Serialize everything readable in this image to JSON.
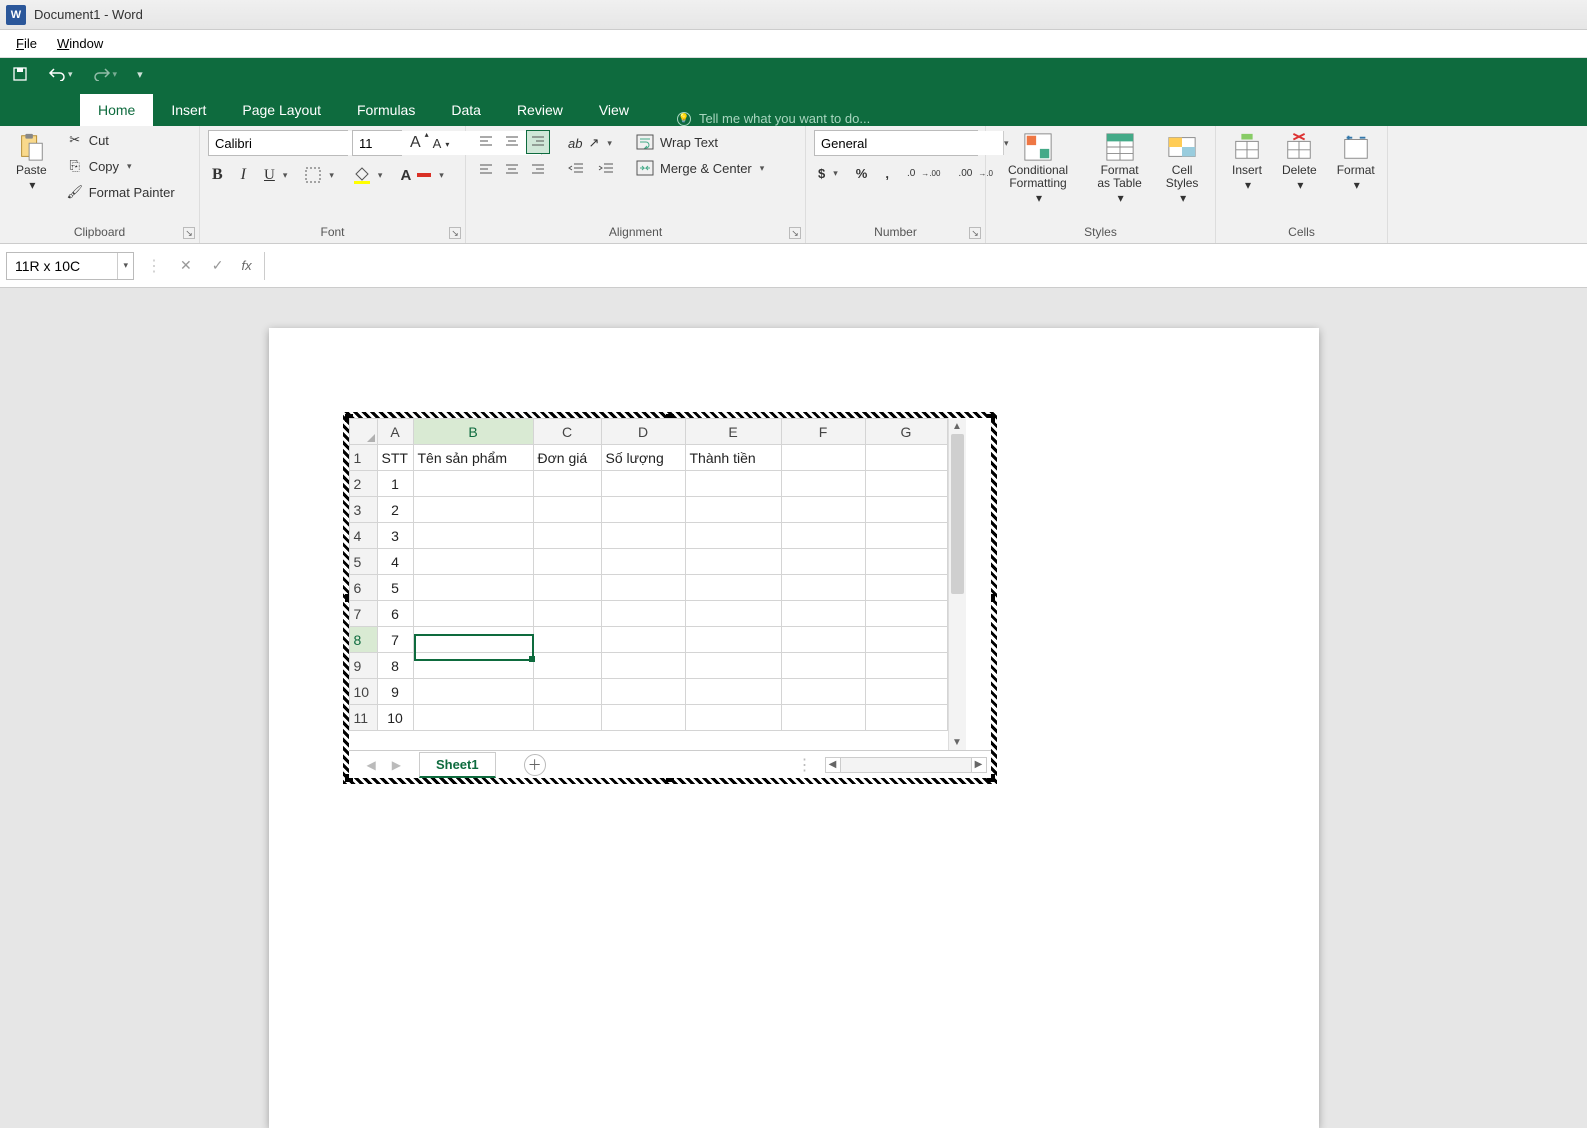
{
  "title": "Document1 - Word",
  "menu": {
    "file": "File",
    "window": "Window"
  },
  "qat": {
    "save": "save",
    "undo": "undo",
    "redo": "redo",
    "customize": "customize"
  },
  "tabs": {
    "home": "Home",
    "insert": "Insert",
    "pageLayout": "Page Layout",
    "formulas": "Formulas",
    "data": "Data",
    "review": "Review",
    "view": "View"
  },
  "tellMe": "Tell me what you want to do...",
  "ribbon": {
    "clipboard": {
      "label": "Clipboard",
      "paste": "Paste",
      "cut": "Cut",
      "copy": "Copy",
      "formatPainter": "Format Painter"
    },
    "font": {
      "label": "Font",
      "name": "Calibri",
      "size": "11",
      "increase": "A",
      "decrease": "A",
      "bold": "B",
      "italic": "I",
      "underline": "U"
    },
    "alignment": {
      "label": "Alignment",
      "wrapText": "Wrap Text",
      "merge": "Merge & Center"
    },
    "number": {
      "label": "Number",
      "format": "General",
      "currency": "$",
      "percent": "%",
      "comma": ",",
      "inc": ".00→.0",
      "dec": ".0→.00"
    },
    "styles": {
      "label": "Styles",
      "conditional": "Conditional Formatting",
      "formatAsTable": "Format as Table",
      "cellStyles": "Cell Styles"
    },
    "cells": {
      "label": "Cells",
      "insert": "Insert",
      "delete": "Delete",
      "format": "Format"
    }
  },
  "nameBox": "11R x 10C",
  "formula": "",
  "sheet": {
    "tabName": "Sheet1",
    "columns": [
      "A",
      "B",
      "C",
      "D",
      "E",
      "F",
      "G"
    ],
    "rows": [
      1,
      2,
      3,
      4,
      5,
      6,
      7,
      8,
      9,
      10,
      11
    ],
    "headers": {
      "A": "STT",
      "B": "Tên sản phẩm",
      "C": "Đơn giá",
      "D": "Số lượng",
      "E": "Thành tiền"
    },
    "stt": [
      1,
      2,
      3,
      4,
      5,
      6,
      7,
      8,
      9,
      10
    ],
    "activeCell": "B8"
  }
}
